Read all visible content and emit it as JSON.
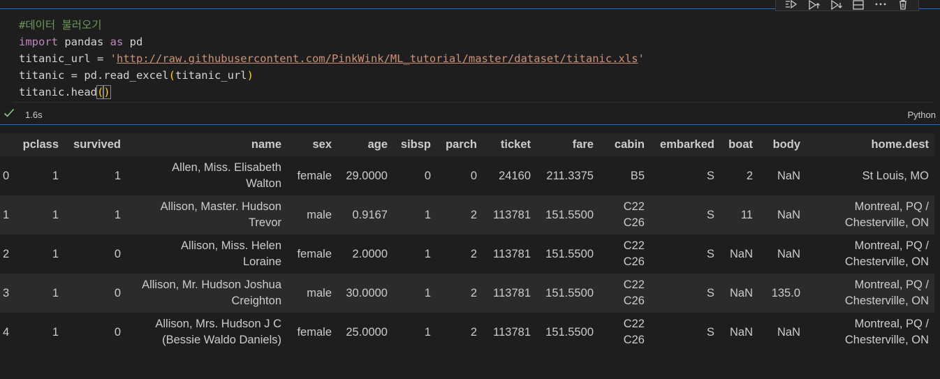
{
  "toolbar": {
    "icons": [
      "run-by-line-icon",
      "execute-above-icon",
      "execute-below-icon",
      "split-cell-icon",
      "more-icon",
      "delete-icon"
    ]
  },
  "code": {
    "l1": "#데이터 불러오기",
    "l2_kw": "import",
    "l2_mod": " pandas ",
    "l2_as": "as",
    "l2_alias": " pd",
    "l3_var": "titanic_url = ",
    "l3_q1": "'",
    "l3_url": "http://raw.githubusercontent.com/PinkWink/ML_tutorial/master/dataset/titanic.xls",
    "l3_q2": "'",
    "l4_a": "titanic = pd.read_excel",
    "l4_open": "(",
    "l4_arg": "titanic_url",
    "l4_close": ")",
    "l5_a": "titanic.head",
    "l5_open": "(",
    "l5_close": ")"
  },
  "status": {
    "time": "1.6s",
    "language": "Python",
    "success_color": "#89d185"
  },
  "table": {
    "columns": [
      "",
      "pclass",
      "survived",
      "name",
      "sex",
      "age",
      "sibsp",
      "parch",
      "ticket",
      "fare",
      "cabin",
      "embarked",
      "boat",
      "body",
      "home.dest"
    ],
    "rows": [
      {
        "idx": "0",
        "pclass": "1",
        "survived": "1",
        "name": [
          "Allen, Miss. Elisabeth",
          "Walton"
        ],
        "sex": "female",
        "age": "29.0000",
        "sibsp": "0",
        "parch": "0",
        "ticket": "24160",
        "fare": "211.3375",
        "cabin": [
          "B5"
        ],
        "embarked": "S",
        "boat": "2",
        "body": "NaN",
        "home": [
          "St Louis, MO"
        ]
      },
      {
        "idx": "1",
        "pclass": "1",
        "survived": "1",
        "name": [
          "Allison, Master. Hudson",
          "Trevor"
        ],
        "sex": "male",
        "age": "0.9167",
        "sibsp": "1",
        "parch": "2",
        "ticket": "113781",
        "fare": "151.5500",
        "cabin": [
          "C22",
          "C26"
        ],
        "embarked": "S",
        "boat": "11",
        "body": "NaN",
        "home": [
          "Montreal, PQ /",
          "Chesterville, ON"
        ]
      },
      {
        "idx": "2",
        "pclass": "1",
        "survived": "0",
        "name": [
          "Allison, Miss. Helen",
          "Loraine"
        ],
        "sex": "female",
        "age": "2.0000",
        "sibsp": "1",
        "parch": "2",
        "ticket": "113781",
        "fare": "151.5500",
        "cabin": [
          "C22",
          "C26"
        ],
        "embarked": "S",
        "boat": "NaN",
        "body": "NaN",
        "home": [
          "Montreal, PQ /",
          "Chesterville, ON"
        ]
      },
      {
        "idx": "3",
        "pclass": "1",
        "survived": "0",
        "name": [
          "Allison, Mr. Hudson Joshua",
          "Creighton"
        ],
        "sex": "male",
        "age": "30.0000",
        "sibsp": "1",
        "parch": "2",
        "ticket": "113781",
        "fare": "151.5500",
        "cabin": [
          "C22",
          "C26"
        ],
        "embarked": "S",
        "boat": "NaN",
        "body": "135.0",
        "home": [
          "Montreal, PQ /",
          "Chesterville, ON"
        ]
      },
      {
        "idx": "4",
        "pclass": "1",
        "survived": "0",
        "name": [
          "Allison, Mrs. Hudson J C",
          "(Bessie Waldo Daniels)"
        ],
        "sex": "female",
        "age": "25.0000",
        "sibsp": "1",
        "parch": "2",
        "ticket": "113781",
        "fare": "151.5500",
        "cabin": [
          "C22",
          "C26"
        ],
        "embarked": "S",
        "boat": "NaN",
        "body": "NaN",
        "home": [
          "Montreal, PQ /",
          "Chesterville, ON"
        ]
      }
    ]
  }
}
